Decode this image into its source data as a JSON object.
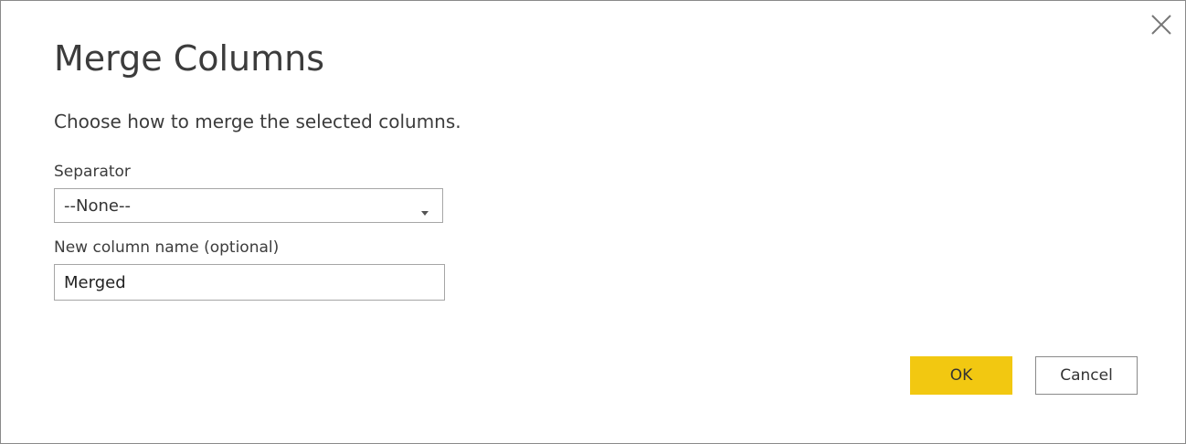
{
  "dialog": {
    "title": "Merge Columns",
    "subtitle": "Choose how to merge the selected columns.",
    "close_icon": "close-icon"
  },
  "separator": {
    "label": "Separator",
    "selected": "--None--",
    "arrow_icon": "dropdown-arrow-icon"
  },
  "new_column": {
    "label": "New column name (optional)",
    "value": "Merged"
  },
  "buttons": {
    "ok_label": "OK",
    "cancel_label": "Cancel"
  },
  "colors": {
    "accent": "#f2c811",
    "border": "#a6a6a6",
    "text": "#333333"
  }
}
